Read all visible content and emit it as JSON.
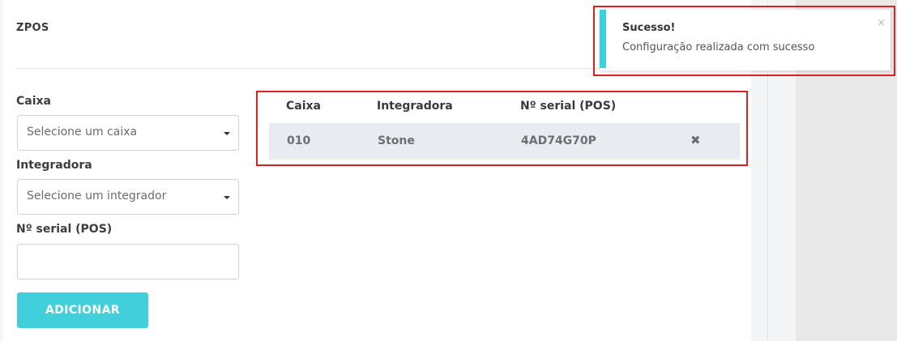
{
  "panel": {
    "title": "ZPOS"
  },
  "form": {
    "caixa_label": "Caixa",
    "caixa_placeholder": "Selecione um caixa",
    "integradora_label": "Integradora",
    "integradora_placeholder": "Selecione um integrador",
    "serial_label": "Nº serial (POS)",
    "serial_value": "",
    "add_label": "ADICIONAR"
  },
  "table": {
    "headers": [
      "Caixa",
      "Integradora",
      "Nº serial (POS)"
    ],
    "rows": [
      {
        "caixa": "010",
        "integradora": "Stone",
        "serial": "4AD74G70P",
        "remove_icon": "✖"
      }
    ]
  },
  "toast": {
    "title": "Sucesso!",
    "message": "Configuração realizada com sucesso",
    "close_icon": "×",
    "accent_color": "#40cfdb"
  },
  "colors": {
    "accent": "#40cfdb",
    "highlight_border": "#e02020"
  }
}
